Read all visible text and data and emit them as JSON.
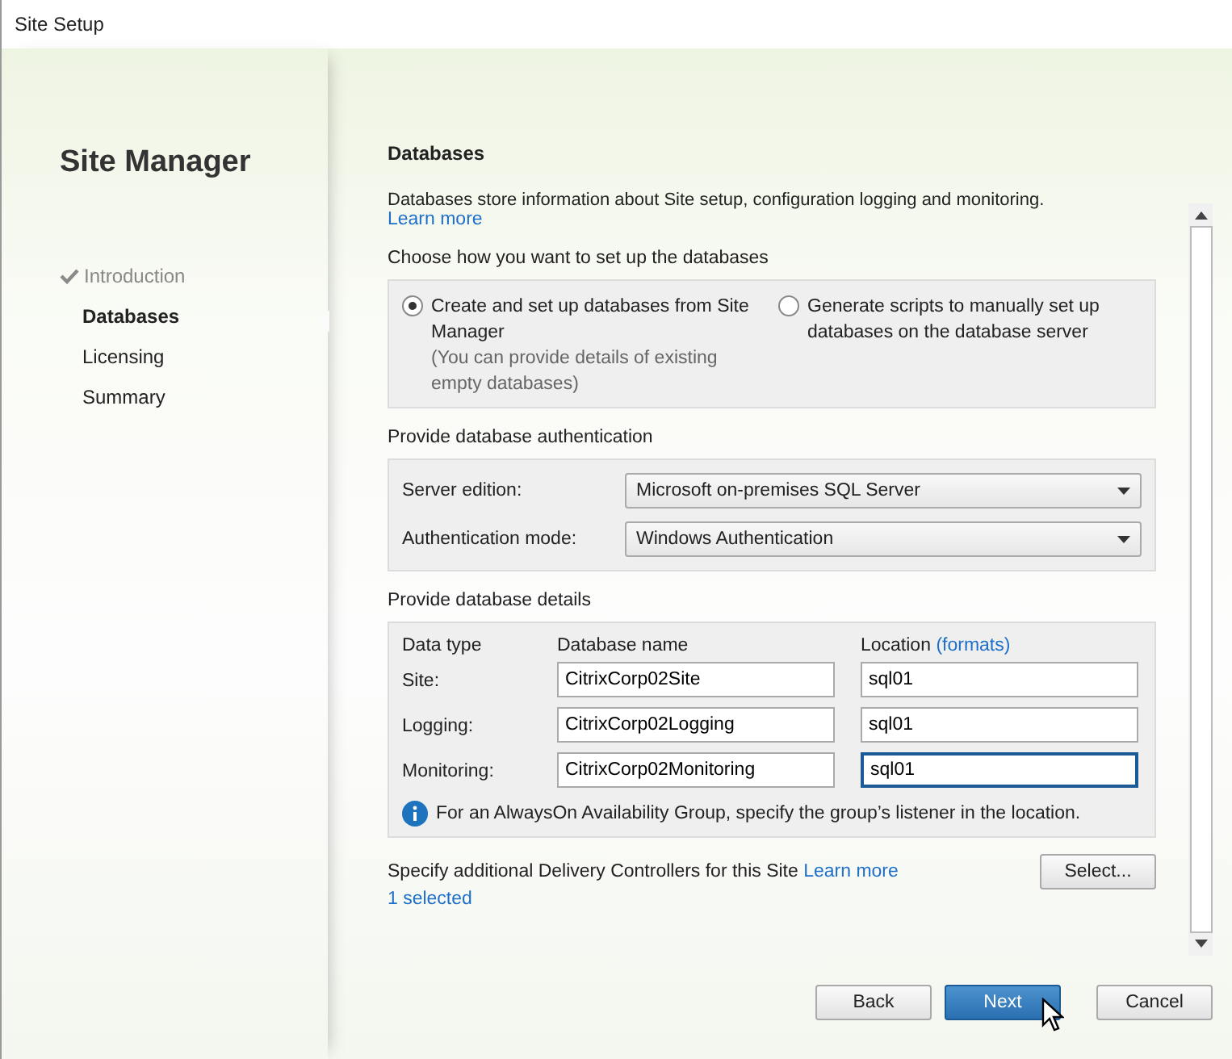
{
  "window": {
    "title": "Site Setup"
  },
  "sidebar": {
    "title": "Site Manager",
    "steps": [
      {
        "label": "Introduction",
        "done": true,
        "selected": false
      },
      {
        "label": "Databases",
        "done": false,
        "selected": true
      },
      {
        "label": "Licensing",
        "done": false,
        "selected": false
      },
      {
        "label": "Summary",
        "done": false,
        "selected": false
      }
    ]
  },
  "page": {
    "heading": "Databases",
    "description": "Databases store information about Site setup, configuration logging and monitoring.",
    "description_link": "Learn more",
    "setup_label": "Choose how you want to set up the databases",
    "setup_options": [
      {
        "label": "Create and set up databases from Site Manager",
        "note": "(You can provide details of existing empty databases)",
        "selected": true
      },
      {
        "label": "Generate scripts to manually set up databases on the database server",
        "selected": false
      }
    ],
    "auth_label": "Provide database authentication",
    "auth_fields": [
      {
        "label": "Server edition:",
        "value": "Microsoft on-premises SQL Server"
      },
      {
        "label": "Authentication mode:",
        "value": "Windows Authentication"
      }
    ],
    "details_label": "Provide database details",
    "details_columns": {
      "type": "Data type",
      "name": "Database name",
      "location": "Location",
      "location_link": "(formats)"
    },
    "details_rows": [
      {
        "type": "Site:",
        "name": "CitrixCorp02Site",
        "location": "sql01",
        "focused": false
      },
      {
        "type": "Logging:",
        "name": "CitrixCorp02Logging",
        "location": "sql01",
        "focused": false
      },
      {
        "type": "Monitoring:",
        "name": "CitrixCorp02Monitoring",
        "location": "sql01",
        "focused": true
      }
    ],
    "info_note": "For an AlwaysOn Availability Group, specify the group’s listener in the location.",
    "controllers_label": "Specify additional Delivery Controllers for this Site",
    "controllers_link": "Learn more",
    "select_button": "Select...",
    "selected_count": "1 selected"
  },
  "buttons": [
    {
      "label": "Back",
      "kind": "normal"
    },
    {
      "label": "Next",
      "kind": "primary"
    },
    {
      "label": "Cancel",
      "kind": "normal"
    }
  ]
}
